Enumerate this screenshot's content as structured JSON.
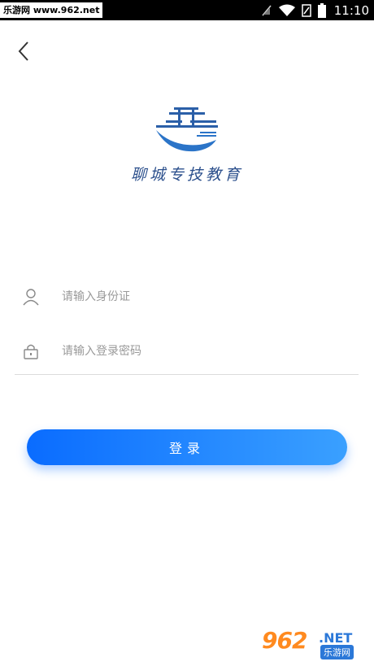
{
  "status_bar": {
    "watermark_text": "乐游网 www.962.net",
    "time": "11:10",
    "icons": [
      "signal-off-icon",
      "wifi-icon",
      "sim-icon",
      "battery-icon"
    ]
  },
  "header": {
    "back_icon": "chevron-left-icon"
  },
  "logo": {
    "text": "聊城专技教育"
  },
  "form": {
    "id_field": {
      "placeholder": "请输入身份证",
      "value": "",
      "icon": "user-icon"
    },
    "password_field": {
      "placeholder": "请输入登录密码",
      "value": "",
      "icon": "lock-icon"
    },
    "login_label": "登录"
  },
  "watermark": {
    "number": "962",
    "suffix": ".NET",
    "name": "乐游网"
  },
  "colors": {
    "primary_start": "#0a6cff",
    "primary_end": "#3aa0ff",
    "logo": "#2b4f8c"
  }
}
